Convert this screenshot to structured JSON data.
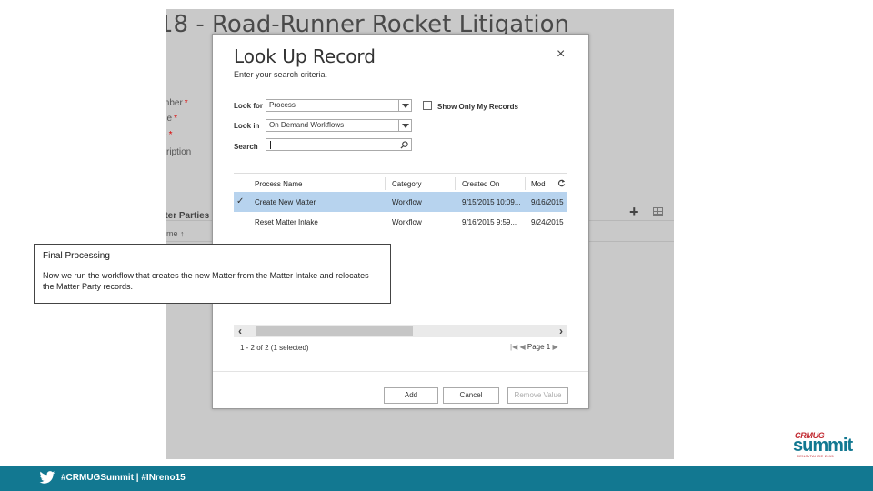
{
  "background": {
    "record_title": "18 - Road-Runner Rocket Litigation",
    "fields": [
      {
        "label": "mber",
        "required": true
      },
      {
        "label": "ne",
        "required": true
      },
      {
        "label": "e",
        "required": true
      },
      {
        "label": "cription",
        "required": false
      }
    ],
    "required_marker": "*",
    "subgrid_title": "tter Parties",
    "subgrid_column": "ame ↑",
    "add_icon": "plus-icon",
    "grid_icon": "grid-view-icon"
  },
  "dialog": {
    "title": "Look Up Record",
    "subtitle": "Enter your search criteria.",
    "close_icon": "×",
    "look_for": {
      "label": "Look for",
      "value": "Process"
    },
    "look_in": {
      "label": "Look in",
      "value": "On Demand Workflows"
    },
    "search": {
      "label": "Search",
      "value": ""
    },
    "show_only_my_records": {
      "label": "Show Only My Records",
      "checked": false
    },
    "columns": [
      "Process Name",
      "Category",
      "Created On",
      "Mod"
    ],
    "rows": [
      {
        "selected": true,
        "cells": [
          "Create New Matter",
          "Workflow",
          "9/15/2015 10:09...",
          "9/16/2015"
        ]
      },
      {
        "selected": false,
        "cells": [
          "Reset Matter Intake",
          "Workflow",
          "9/16/2015 9:59...",
          "9/24/2015"
        ]
      }
    ],
    "selected_check": "✓",
    "paging_text": "1 - 2 of 2 (1 selected)",
    "page_label": "Page 1",
    "buttons": {
      "add": "Add",
      "cancel": "Cancel",
      "remove": "Remove Value"
    },
    "selection_color": "#b7d3ee"
  },
  "callout": {
    "title": "Final Processing",
    "body": "Now we run the workflow that creates the new Matter from the Matter Intake and relocates the Matter Party records."
  },
  "footer": {
    "text": "#CRMUGSummit | #INreno15",
    "color": "#127891"
  },
  "logo": {
    "top": "CRMUG",
    "main": "summit",
    "sub": "RENO•TAHOE 2015"
  }
}
